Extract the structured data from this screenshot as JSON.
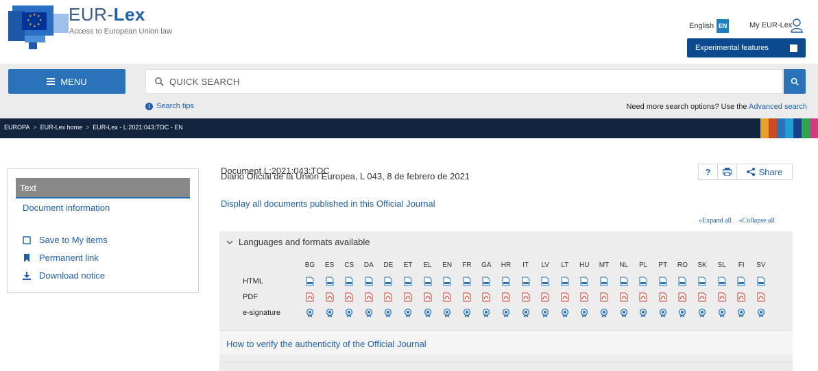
{
  "header": {
    "brand_prefix": "EUR-",
    "brand_bold": "Lex",
    "brand_subtitle": "Access to European Union law",
    "language_label": "English",
    "language_code": "EN",
    "my_eurlex": "My EUR-Lex",
    "experimental_features": "Experimental features"
  },
  "search": {
    "menu_label": "MENU",
    "placeholder": "QUICK SEARCH",
    "tips_label": "Search tips",
    "advanced_prefix": "Need more search options? Use the ",
    "advanced_link": "Advanced search"
  },
  "breadcrumb": [
    "EUROPA",
    "EUR-Lex home",
    "EUR-Lex - L:2021:043:TOC - EN"
  ],
  "sidebar": {
    "heading": "Text",
    "doc_info": "Document information",
    "items": [
      {
        "label": "Save to My items",
        "icon": "bookmark-outline-icon"
      },
      {
        "label": "Permanent link",
        "icon": "bookmark-icon"
      },
      {
        "label": "Download notice",
        "icon": "download-icon"
      }
    ]
  },
  "main": {
    "document_title": "Document L:2021:043:TOC",
    "oj_line": "Diario Oficial de la Unión Europea, L 043, 8 de febrero de 2021",
    "display_all": "Display all documents published in this Official Journal",
    "expand_all": "Expand all",
    "collapse_all": "Collapse all",
    "share_label": "Share",
    "help_label": "?",
    "panel_title": "Languages and formats available",
    "verify_link": "How to verify the authenticity of the Official Journal"
  },
  "formats": {
    "languages": [
      "BG",
      "ES",
      "CS",
      "DA",
      "DE",
      "ET",
      "EL",
      "EN",
      "FR",
      "GA",
      "HR",
      "IT",
      "LV",
      "LT",
      "HU",
      "MT",
      "NL",
      "PL",
      "PT",
      "RO",
      "SK",
      "SL",
      "FI",
      "SV"
    ],
    "rows": [
      {
        "label": "HTML",
        "icon": "html-file-icon"
      },
      {
        "label": "PDF",
        "icon": "pdf-file-icon"
      },
      {
        "label": "e-signature",
        "icon": "e-signature-seal-icon"
      }
    ]
  },
  "colors": {
    "brand_blue": "#2a72ba",
    "dark_navy": "#12243d",
    "link_blue": "#1f5fb1",
    "pdf_red": "#d33a2c"
  }
}
